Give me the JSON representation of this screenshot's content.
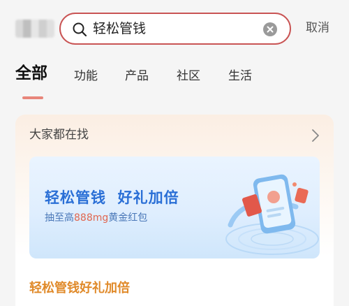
{
  "search": {
    "query": "轻松管钱",
    "cancel_label": "取消"
  },
  "tabs": [
    {
      "label": "全部",
      "active": true
    },
    {
      "label": "功能",
      "active": false
    },
    {
      "label": "产品",
      "active": false
    },
    {
      "label": "社区",
      "active": false
    },
    {
      "label": "生活",
      "active": false
    }
  ],
  "card": {
    "header": "大家都在找",
    "banner": {
      "title": "轻松管钱  好礼加倍",
      "subtitle_prefix": "抽至高",
      "subtitle_highlight": "888mg",
      "subtitle_suffix": "黄金红包"
    },
    "promo_title": "轻松管钱好礼加倍"
  },
  "colors": {
    "accent_red": "#c95454",
    "banner_blue": "#2a6fd6",
    "promo_orange": "#e08a2a",
    "highlight_red": "#e0664f"
  }
}
